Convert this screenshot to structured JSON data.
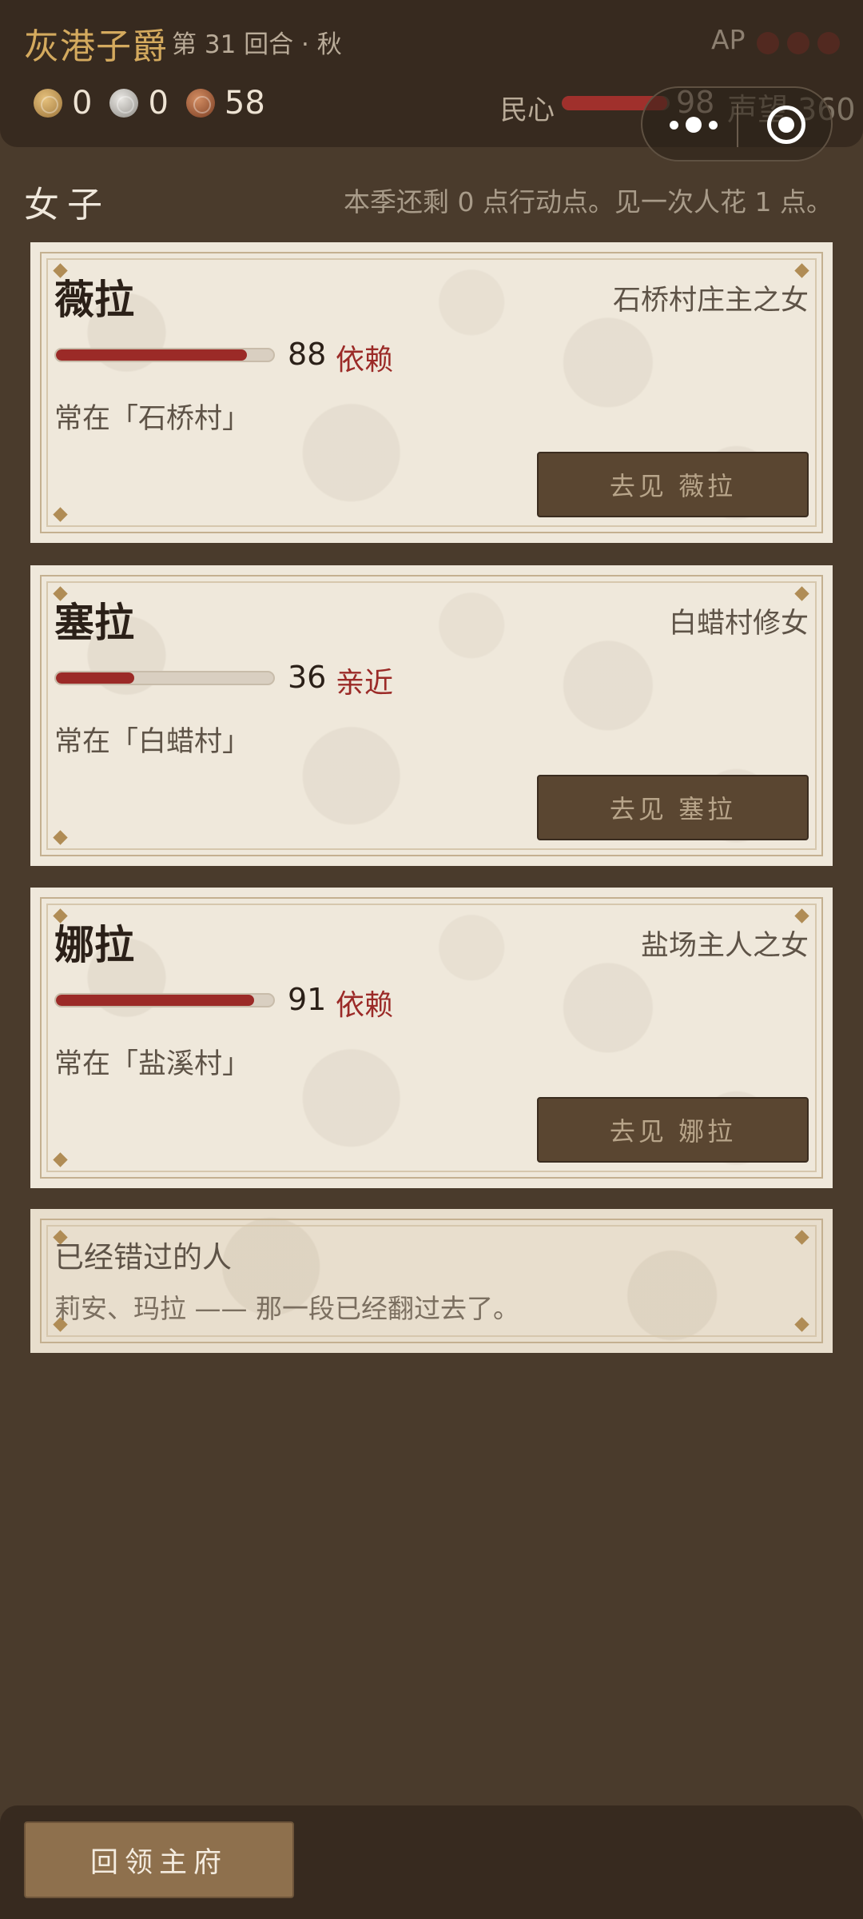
{
  "header": {
    "title": "灰港子爵",
    "turn": "第 31 回合 · 秋",
    "ap_label": "AP",
    "ap_dots": 3,
    "resources": {
      "gold": "0",
      "silver": "0",
      "copper": "58"
    },
    "minxin_label": "民心",
    "minxin_value": "98",
    "minxin_fraction": 0.98,
    "fame_text": "声望 360"
  },
  "section": {
    "title": "女子",
    "hint": "本季还剩 0 点行动点。见一次人花 1 点。"
  },
  "women": [
    {
      "name": "薇拉",
      "role": "石桥村庄主之女",
      "affection": "88",
      "affection_fraction": 0.88,
      "status": "依赖",
      "location": "常在「石桥村」",
      "button": "去见 薇拉"
    },
    {
      "name": "塞拉",
      "role": "白蜡村修女",
      "affection": "36",
      "affection_fraction": 0.36,
      "status": "亲近",
      "location": "常在「白蜡村」",
      "button": "去见 塞拉"
    },
    {
      "name": "娜拉",
      "role": "盐场主人之女",
      "affection": "91",
      "affection_fraction": 0.91,
      "status": "依赖",
      "location": "常在「盐溪村」",
      "button": "去见 娜拉"
    }
  ],
  "missed": {
    "title": "已经错过的人",
    "text": "莉安、玛拉 —— 那一段已经翻过去了。"
  },
  "footer": {
    "return_button": "回领主府"
  },
  "colors": {
    "background": "#4a3b2c",
    "bar": "#372a1f",
    "title_gold": "#d4aa5e",
    "card": "#efe8db",
    "accent_red": "#9b2a27",
    "button_brown": "#5a4631"
  }
}
